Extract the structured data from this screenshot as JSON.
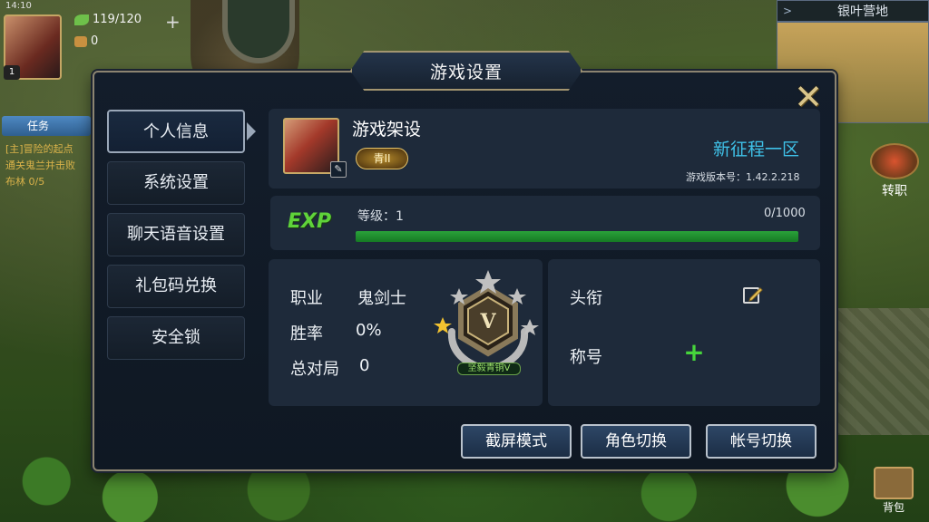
{
  "hud": {
    "time": "14:10",
    "player_level": "1",
    "stamina": "119/120",
    "currency": "0",
    "plus": "+",
    "task_tab": "任务",
    "quest_line1": "[主]冒险的起点",
    "quest_line2": "通关鬼兰并击败",
    "quest_line3": "布林 0/5"
  },
  "minimap": {
    "toggle": ">",
    "title": "银叶营地"
  },
  "side_buttons": {
    "change_job": "转职",
    "bag": "背包"
  },
  "dialog": {
    "title": "游戏设置",
    "close_symbol": "✕",
    "nav": [
      {
        "label": "个人信息"
      },
      {
        "label": "系统设置"
      },
      {
        "label": "聊天语音设置"
      },
      {
        "label": "礼包码兑换"
      },
      {
        "label": "安全锁"
      }
    ],
    "profile": {
      "name": "游戏架设",
      "badge": "青II",
      "server": "新征程一区",
      "version": "游戏版本号：1.42.2.218"
    },
    "exp": {
      "label": "EXP",
      "level_text": "等级：1",
      "count": "0/1000",
      "fill_fraction": 1.0
    },
    "stats": {
      "job_label": "职业",
      "job_value": "鬼剑士",
      "winrate_label": "胜率",
      "winrate_value": "0%",
      "total_label": "总对局",
      "total_value": "0"
    },
    "rank": {
      "letter": "V",
      "caption": "坚毅青铜V"
    },
    "titles": {
      "head_label": "头衔",
      "honor_label": "称号",
      "add_symbol": "+"
    },
    "buttons": {
      "screenshot": "截屏模式",
      "switch_role": "角色切换",
      "switch_account": "帐号切换"
    }
  },
  "colors": {
    "accent_blue": "#3fc1e8",
    "exp_green": "#5fd33a",
    "panel_bg": "#1e2a3a",
    "frame_gold": "#a39570"
  }
}
